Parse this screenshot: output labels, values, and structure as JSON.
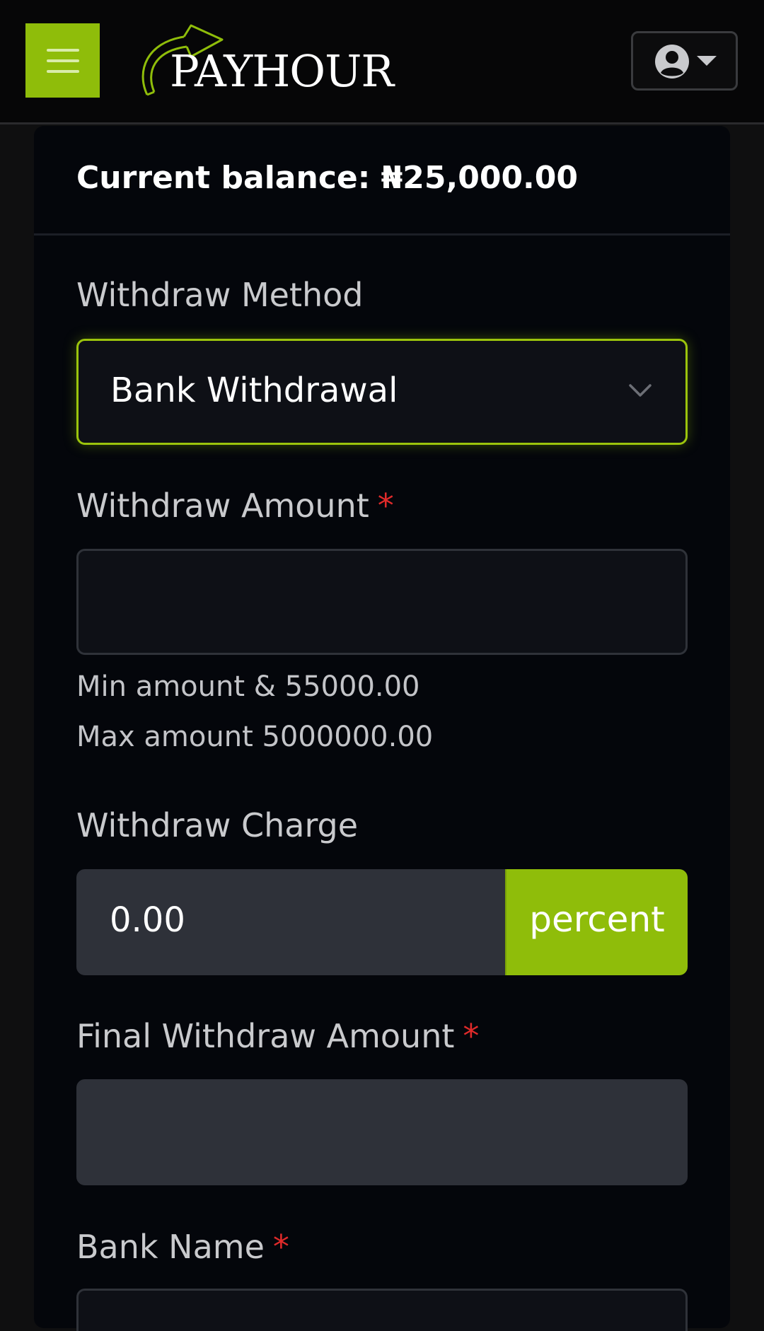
{
  "header": {
    "menu_icon": "hamburger-icon",
    "logo_text": "PAYHOUR",
    "logo_icon": "curved-arrow-icon",
    "user_icon": "user-circle-icon",
    "caret_icon": "caret-down-icon"
  },
  "card": {
    "balance_text": "Current balance: ₦25,000.00"
  },
  "form": {
    "method_label": "Withdraw Method",
    "method_value": "Bank Withdrawal",
    "amount_label": "Withdraw Amount",
    "amount_value": "",
    "required_mark": "*",
    "min_hint": "Min amount & 55000.00",
    "max_hint": "Max amount 5000000.00",
    "charge_label": "Withdraw Charge",
    "charge_value": "0.00",
    "charge_unit": "percent",
    "final_label": "Final Withdraw Amount",
    "final_value": "",
    "bank_label": "Bank Name"
  },
  "colors": {
    "accent": "#8fbd0a",
    "background": "#04060b",
    "required": "#e02a2a"
  }
}
